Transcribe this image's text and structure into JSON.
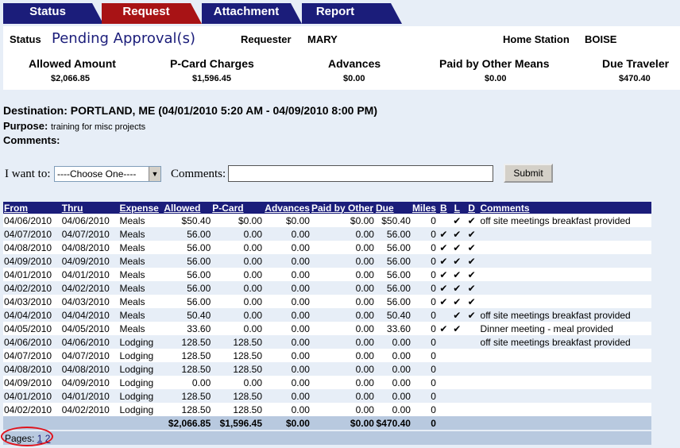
{
  "tabs": [
    {
      "label": "Status",
      "active": false
    },
    {
      "label": "Request",
      "active": true
    },
    {
      "label": "Attachment",
      "active": false
    },
    {
      "label": "Report",
      "active": false
    }
  ],
  "header": {
    "status_label": "Status",
    "status_value": "Pending Approval(s)",
    "requester_label": "Requester",
    "requester_value": "MARY",
    "home_station_label": "Home Station",
    "home_station_value": "BOISE",
    "amounts": [
      {
        "label": "Allowed Amount",
        "value": "$2,066.85"
      },
      {
        "label": "P-Card Charges",
        "value": "$1,596.45"
      },
      {
        "label": "Advances",
        "value": "$0.00"
      },
      {
        "label": "Paid by Other Means",
        "value": "$0.00"
      },
      {
        "label": "Due Traveler",
        "value": "$470.40"
      }
    ]
  },
  "trip": {
    "destination_label": "Destination:",
    "destination_value": "PORTLAND, ME (04/01/2010 5:20 AM - 04/09/2010 8:00 PM)",
    "purpose_label": "Purpose:",
    "purpose_value": "training for misc projects",
    "comments_label": "Comments:"
  },
  "action": {
    "i_want_to_label": "I want to:",
    "select_value": "----Choose One----",
    "comments_label": "Comments:",
    "comments_value": "",
    "submit_label": "Submit"
  },
  "table": {
    "columns": [
      "From",
      "Thru",
      "Expense",
      "Allowed",
      "P-Card",
      "Advances",
      "Paid by Other",
      "Due",
      "Miles",
      "B",
      "L",
      "D",
      "Comments"
    ],
    "rows": [
      [
        "04/06/2010",
        "04/06/2010",
        "Meals",
        "$50.40",
        "$0.00",
        "$0.00",
        "$0.00",
        "$50.40",
        "0",
        "",
        "✔",
        "✔",
        "off site meetings breakfast provided"
      ],
      [
        "04/07/2010",
        "04/07/2010",
        "Meals",
        "56.00",
        "0.00",
        "0.00",
        "0.00",
        "56.00",
        "0",
        "✔",
        "✔",
        "✔",
        ""
      ],
      [
        "04/08/2010",
        "04/08/2010",
        "Meals",
        "56.00",
        "0.00",
        "0.00",
        "0.00",
        "56.00",
        "0",
        "✔",
        "✔",
        "✔",
        ""
      ],
      [
        "04/09/2010",
        "04/09/2010",
        "Meals",
        "56.00",
        "0.00",
        "0.00",
        "0.00",
        "56.00",
        "0",
        "✔",
        "✔",
        "✔",
        ""
      ],
      [
        "04/01/2010",
        "04/01/2010",
        "Meals",
        "56.00",
        "0.00",
        "0.00",
        "0.00",
        "56.00",
        "0",
        "✔",
        "✔",
        "✔",
        ""
      ],
      [
        "04/02/2010",
        "04/02/2010",
        "Meals",
        "56.00",
        "0.00",
        "0.00",
        "0.00",
        "56.00",
        "0",
        "✔",
        "✔",
        "✔",
        ""
      ],
      [
        "04/03/2010",
        "04/03/2010",
        "Meals",
        "56.00",
        "0.00",
        "0.00",
        "0.00",
        "56.00",
        "0",
        "✔",
        "✔",
        "✔",
        ""
      ],
      [
        "04/04/2010",
        "04/04/2010",
        "Meals",
        "50.40",
        "0.00",
        "0.00",
        "0.00",
        "50.40",
        "0",
        "",
        "✔",
        "✔",
        "off site meetings breakfast provided"
      ],
      [
        "04/05/2010",
        "04/05/2010",
        "Meals",
        "33.60",
        "0.00",
        "0.00",
        "0.00",
        "33.60",
        "0",
        "✔",
        "✔",
        "",
        "Dinner meeting - meal provided"
      ],
      [
        "04/06/2010",
        "04/06/2010",
        "Lodging",
        "128.50",
        "128.50",
        "0.00",
        "0.00",
        "0.00",
        "0",
        "",
        "",
        "",
        "off site meetings breakfast provided"
      ],
      [
        "04/07/2010",
        "04/07/2010",
        "Lodging",
        "128.50",
        "128.50",
        "0.00",
        "0.00",
        "0.00",
        "0",
        "",
        "",
        "",
        ""
      ],
      [
        "04/08/2010",
        "04/08/2010",
        "Lodging",
        "128.50",
        "128.50",
        "0.00",
        "0.00",
        "0.00",
        "0",
        "",
        "",
        "",
        ""
      ],
      [
        "04/09/2010",
        "04/09/2010",
        "Lodging",
        "0.00",
        "0.00",
        "0.00",
        "0.00",
        "0.00",
        "0",
        "",
        "",
        "",
        ""
      ],
      [
        "04/01/2010",
        "04/01/2010",
        "Lodging",
        "128.50",
        "128.50",
        "0.00",
        "0.00",
        "0.00",
        "0",
        "",
        "",
        "",
        ""
      ],
      [
        "04/02/2010",
        "04/02/2010",
        "Lodging",
        "128.50",
        "128.50",
        "0.00",
        "0.00",
        "0.00",
        "0",
        "",
        "",
        "",
        ""
      ]
    ],
    "totals": [
      "",
      "",
      "",
      "$2,066.85",
      "$1,596.45",
      "$0.00",
      "$0.00",
      "$470.40",
      "0",
      "",
      "",
      "",
      ""
    ]
  },
  "pager": {
    "label": "Pages:",
    "pages": [
      "1",
      "2"
    ]
  },
  "colors": {
    "tab_blue": "#1b1d7a",
    "tab_red": "#a81315",
    "annotation_red": "#e0141d"
  }
}
